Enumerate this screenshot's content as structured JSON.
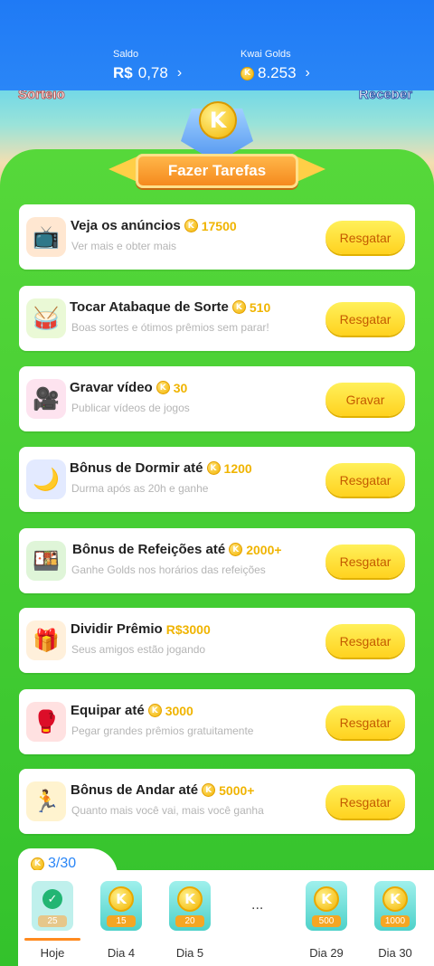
{
  "header": {
    "saldo_label": "Saldo",
    "saldo_currency": "R$",
    "saldo_value": "0,78",
    "golds_label": "Kwai Golds",
    "golds_value": "8.253",
    "chevron": "›"
  },
  "beach": {
    "left_text": "Sorteio",
    "right_text": "Receber"
  },
  "banner": {
    "coin_letter": "K",
    "title": "Fazer Tarefas"
  },
  "coin_letter": "K",
  "tasks": [
    {
      "title": "Veja os anúncios",
      "reward": "17500",
      "reward_type": "coin",
      "subtitle": "Ver mais e obter mais",
      "button": "Resgatar",
      "icon": "tv-icon"
    },
    {
      "title": "Tocar Atabaque de Sorte",
      "reward": "510",
      "reward_type": "coin",
      "subtitle": "Boas sortes e ótimos prêmios sem parar!",
      "button": "Resgatar",
      "icon": "drum-icon"
    },
    {
      "title": "Gravar vídeo",
      "reward": "30",
      "reward_type": "coin",
      "subtitle": "Publicar vídeos de jogos",
      "button": "Gravar",
      "icon": "video-camera-icon"
    },
    {
      "title": "Bônus de Dormir até",
      "reward": "1200",
      "reward_type": "coin",
      "subtitle": "Durma após as 20h e ganhe",
      "button": "Resgatar",
      "icon": "moon-icon"
    },
    {
      "title": "Bônus de Refeições até",
      "reward": "2000+",
      "reward_type": "coin",
      "subtitle": "Ganhe Golds nos horários das refeições",
      "button": "Resgatar",
      "icon": "lunchbox-icon"
    },
    {
      "title": "Dividir Prêmio",
      "reward": "R$3000",
      "reward_type": "money",
      "subtitle": "Seus amigos estão jogando",
      "button": "Resgatar",
      "icon": "gift-icon"
    },
    {
      "title": "Equipar até",
      "reward": "3000",
      "reward_type": "coin",
      "subtitle": "Pegar grandes prêmios gratuitamente",
      "button": "Resgatar",
      "icon": "boxing-gloves-icon"
    },
    {
      "title": "Bônus de Andar até",
      "reward": "5000+",
      "reward_type": "coin",
      "subtitle": "Quanto mais você vai, mais você ganha",
      "button": "Resgatar",
      "icon": "walking-kid-icon"
    }
  ],
  "checkin": {
    "progress": "3/30",
    "ellipsis": "...",
    "days": [
      {
        "label": "Hoje",
        "amount": "25",
        "done": true
      },
      {
        "label": "Dia 4",
        "amount": "15"
      },
      {
        "label": "Dia 5",
        "amount": "20"
      },
      {
        "label": "Dia 29",
        "amount": "500"
      },
      {
        "label": "Dia 30",
        "amount": "1000"
      }
    ]
  },
  "colors": {
    "header_blue": "#2a86f7",
    "panel_green": "#3cc43a",
    "button_yellow": "#ffd21f",
    "reward_gold": "#f0b400"
  }
}
